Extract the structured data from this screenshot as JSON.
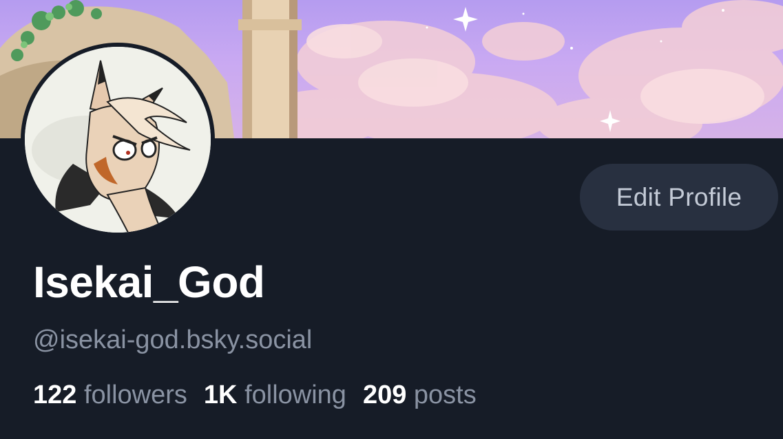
{
  "profile": {
    "display_name": "Isekai_God",
    "handle": "@isekai-god.bsky.social",
    "edit_button_label": "Edit Profile",
    "stats": {
      "followers_count": "122",
      "followers_label": "followers",
      "following_count": "1K",
      "following_label": "following",
      "posts_count": "209",
      "posts_label": "posts"
    }
  },
  "colors": {
    "background": "#161c27",
    "button_background": "#283040",
    "button_text": "#c3cad6",
    "primary_text": "#ffffff",
    "secondary_text": "#8a93a3"
  },
  "images": {
    "banner": "anime-sky-banner",
    "avatar": "cartoon-character-avatar"
  }
}
